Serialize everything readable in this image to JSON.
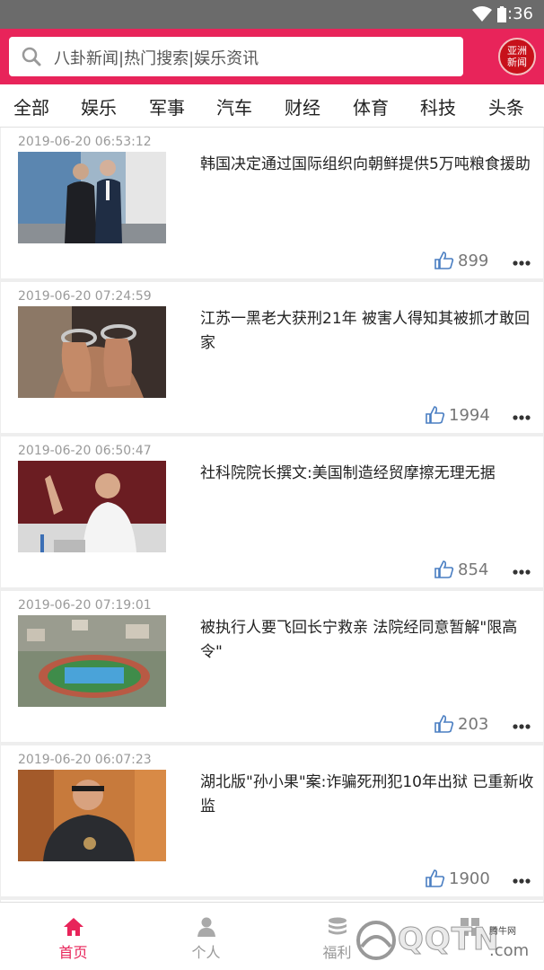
{
  "status_bar": {
    "time": "8:36"
  },
  "header": {
    "search_placeholder": "八卦新闻|热门搜索|娱乐资讯",
    "logo_text": [
      "亚洲",
      "新闻"
    ],
    "colors": {
      "brand": "#e8245a",
      "logo": "#c7111a"
    }
  },
  "tabs": [
    "全部",
    "娱乐",
    "军事",
    "汽车",
    "财经",
    "体育",
    "科技",
    "头条"
  ],
  "news": [
    {
      "date": "2019-06-20 06:53:12",
      "title": "韩国决定通过国际组织向朝鲜提供5万吨粮食援助",
      "likes": "899"
    },
    {
      "date": "2019-06-20 07:24:59",
      "title": "江苏一黑老大获刑21年 被害人得知其被抓才敢回家",
      "likes": "1994"
    },
    {
      "date": "2019-06-20 06:50:47",
      "title": "社科院院长撰文:美国制造经贸摩擦无理无据",
      "likes": "854"
    },
    {
      "date": "2019-06-20 07:19:01",
      "title": "被执行人要飞回长宁救亲 法院经同意暂解\"限高令\"",
      "likes": "203"
    },
    {
      "date": "2019-06-20 06:07:23",
      "title": "湖北版\"孙小果\"案:诈骗死刑犯10年出狱 已重新收监",
      "likes": "1900"
    }
  ],
  "bottom_nav": [
    {
      "label": "首页",
      "icon": "home-icon",
      "active": true
    },
    {
      "label": "个人",
      "icon": "person-icon",
      "active": false
    },
    {
      "label": "福利",
      "icon": "coins-icon",
      "active": false
    },
    {
      "label": "",
      "icon": "grid-icon",
      "active": false
    }
  ],
  "watermark": {
    "text": "QQTN",
    "suffix": ".com",
    "small": "腾牛网"
  }
}
